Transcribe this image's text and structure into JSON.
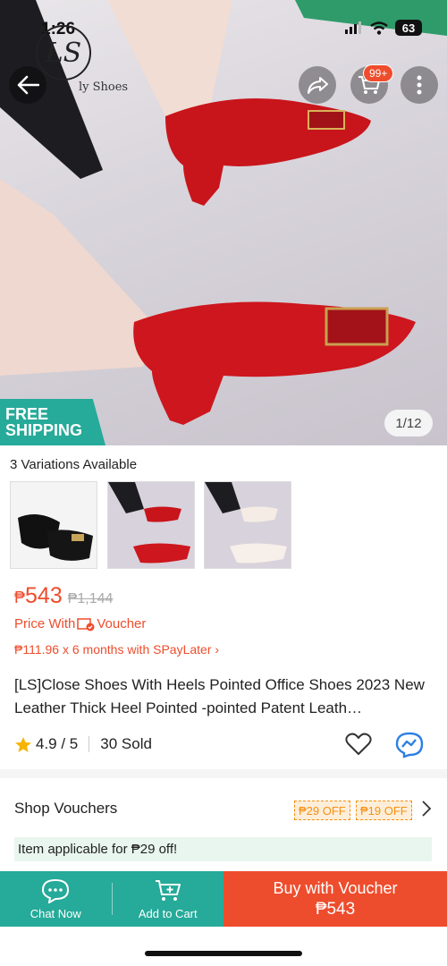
{
  "status_bar": {
    "time": "1:26",
    "battery": "63"
  },
  "brand": {
    "logo_letters": "LS",
    "logo_text": "ly Shoes"
  },
  "header": {
    "cart_badge": "99+"
  },
  "gallery": {
    "free_shipping_line1": "FREE",
    "free_shipping_line2": "SHIPPING",
    "counter": "1/12"
  },
  "variations": {
    "label": "3 Variations Available"
  },
  "price": {
    "currency": "₱",
    "current": "543",
    "original": "₱1,144",
    "voucher_prefix": "Price With",
    "voucher_suffix": "Voucher",
    "paylater_prefix": "₱111.96 x 6 months with",
    "paylater_brand": "SPayLater",
    "paylater_chevron": "›"
  },
  "product": {
    "title": "[LS]Close Shoes With Heels Pointed Office Shoes 2023 New Leather Thick Heel Pointed -pointed Patent Leath…",
    "rating": "4.9 / 5",
    "sold": "30 Sold"
  },
  "vouchers": {
    "label": "Shop Vouchers",
    "tags": [
      "₱29 OFF",
      "₱19 OFF"
    ],
    "banner": "Item applicable for ₱29 off!"
  },
  "bottom_bar": {
    "chat_label": "Chat Now",
    "cart_label": "Add to Cart",
    "buy_label": "Buy with Voucher",
    "buy_amount": "₱543"
  },
  "colors": {
    "brand_orange": "#ee4d2d",
    "teal": "#26aa99",
    "voucher_orange": "#f69113"
  },
  "icons": [
    "back-arrow-icon",
    "share-icon",
    "cart-icon",
    "more-icon",
    "heart-icon",
    "messenger-icon",
    "chat-icon",
    "add-cart-icon",
    "star-icon",
    "voucher-icon",
    "chevron-right-icon"
  ]
}
